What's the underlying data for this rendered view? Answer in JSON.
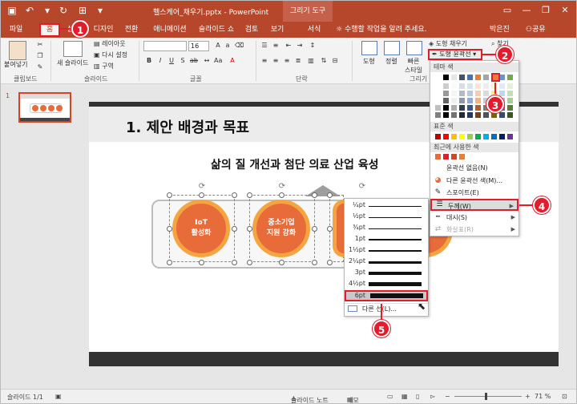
{
  "window": {
    "doc_title": "헬스케어_채우기.pptx - PowerPoint",
    "context_tab_title": "그리기 도구",
    "user": "박은진",
    "share": "공유",
    "tell_me": "수행할 작업을 알려 주세요."
  },
  "tabs": [
    "파일",
    "홈",
    "삽입",
    "디자인",
    "전환",
    "애니메이션",
    "슬라이드 쇼",
    "검토",
    "보기",
    "서식"
  ],
  "ribbon": {
    "clipboard": {
      "paste": "붙여넣기",
      "label": "클립보드"
    },
    "slides": {
      "new_slide": "새 슬라이드",
      "layout": "레이아웃",
      "reset": "다시 설정",
      "section": "구역",
      "label": "슬라이드"
    },
    "font": {
      "size": "16",
      "label": "글꼴"
    },
    "paragraph": {
      "label": "단락"
    },
    "drawing": {
      "shapes": "도형",
      "arrange": "정렬",
      "quick_styles": "빠른\n스타일",
      "label": "그리기",
      "fill": "도형 채우기",
      "outline": "도형 윤곽선",
      "find": "찾기"
    }
  },
  "thumbnail": {
    "number": "1"
  },
  "slide": {
    "title": "1. 제안 배경과 목표",
    "subtitle": "삶의 질 개선과 첨단 의료 산업 육성",
    "circles": [
      "IoT\n활성화",
      "중소기업\n지원 강화"
    ]
  },
  "weight_menu": {
    "items": [
      {
        "label": "¼pt",
        "pt": 0.25
      },
      {
        "label": "½pt",
        "pt": 0.5
      },
      {
        "label": "¾pt",
        "pt": 0.75
      },
      {
        "label": "1pt",
        "pt": 1
      },
      {
        "label": "1½pt",
        "pt": 1.5
      },
      {
        "label": "2¼pt",
        "pt": 2.25
      },
      {
        "label": "3pt",
        "pt": 3
      },
      {
        "label": "4½pt",
        "pt": 4.5
      },
      {
        "label": "6pt",
        "pt": 6
      }
    ],
    "more": "다른 선(L)..."
  },
  "outline_menu": {
    "theme_colors_header": "테마 색",
    "standard_colors_header": "표준 색",
    "recent_colors_header": "최근에 사용한 색",
    "no_outline": "윤곽선 없음(N)",
    "more_colors": "다른 윤곽선 색(M)...",
    "eyedropper": "스포이트(E)",
    "weight": "두께(W)",
    "dashes": "대시(S)",
    "arrows": "화살표(R)",
    "theme_top": [
      "#ffffff",
      "#000000",
      "#e7e6e6",
      "#44546a",
      "#4472c4",
      "#ed7d31",
      "#a5a5a5",
      "#ffc000",
      "#5b9bd5",
      "#70ad47"
    ],
    "standard": [
      "#c00000",
      "#ff0000",
      "#ffc000",
      "#ffff00",
      "#92d050",
      "#00b050",
      "#00b0f0",
      "#0070c0",
      "#002060",
      "#7030a0"
    ],
    "recent": [
      "#e86b3a",
      "#e21c2a",
      "#d24726",
      "#ed7d31"
    ]
  },
  "callouts": [
    "1",
    "2",
    "3",
    "4",
    "5"
  ],
  "status": {
    "slide_info": "슬라이드 1/1",
    "notes": "슬라이드 노트",
    "comments": "메모",
    "zoom": "71 %"
  },
  "colors": {
    "accent": "#b7472a",
    "highlight": "#e21c2a",
    "circle_fill": "#e86b3a",
    "circle_ring": "#f5a53f"
  }
}
